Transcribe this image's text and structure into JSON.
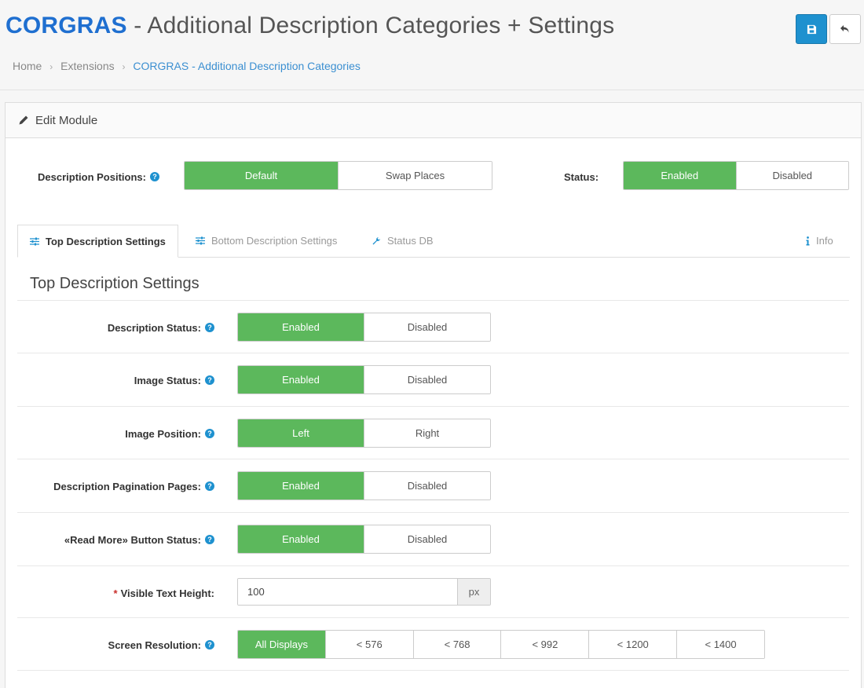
{
  "header": {
    "brand": "CORGRAS",
    "title_rest": " - Additional Description Categories + Settings",
    "save_icon": "save-icon",
    "back_icon": "reply-icon"
  },
  "breadcrumb": {
    "items": [
      "Home",
      "Extensions",
      "CORGRAS - Additional Description Categories"
    ],
    "separator": "›"
  },
  "panel": {
    "heading": "Edit Module",
    "heading_icon": "pencil-icon"
  },
  "top_controls": {
    "positions_label": "Description Positions:",
    "positions_options": [
      "Default",
      "Swap Places"
    ],
    "positions_selected": "Default",
    "status_label": "Status:",
    "status_options": [
      "Enabled",
      "Disabled"
    ],
    "status_selected": "Enabled"
  },
  "tabs": [
    {
      "label": "Top Description Settings",
      "icon": "sliders-icon",
      "active": true
    },
    {
      "label": "Bottom Description Settings",
      "icon": "sliders-icon",
      "active": false
    },
    {
      "label": "Status DB",
      "icon": "wrench-icon",
      "active": false
    },
    {
      "label": "Info",
      "icon": "info-icon",
      "active": false
    }
  ],
  "section": {
    "title": "Top Description Settings",
    "rows": [
      {
        "label": "Description Status:",
        "options": [
          "Enabled",
          "Disabled"
        ],
        "selected": 0
      },
      {
        "label": "Image Status:",
        "options": [
          "Enabled",
          "Disabled"
        ],
        "selected": 0
      },
      {
        "label": "Image Position:",
        "options": [
          "Left",
          "Right"
        ],
        "selected": 0
      },
      {
        "label": "Description Pagination Pages:",
        "options": [
          "Enabled",
          "Disabled"
        ],
        "selected": 0
      },
      {
        "label": "«Read More» Button Status:",
        "options": [
          "Enabled",
          "Disabled"
        ],
        "selected": 0
      }
    ],
    "text_height": {
      "required_mark": "*",
      "label": "Visible Text Height:",
      "value": "100",
      "unit": "px"
    },
    "screen_resolution": {
      "label": "Screen Resolution:",
      "options": [
        "All Displays",
        "< 576",
        "< 768",
        "< 992",
        "< 1200",
        "< 1400"
      ],
      "selected": 0
    }
  },
  "colors": {
    "brand": "#1f6fd0",
    "active_green": "#5cb85c",
    "primary_blue": "#1e91cf"
  }
}
